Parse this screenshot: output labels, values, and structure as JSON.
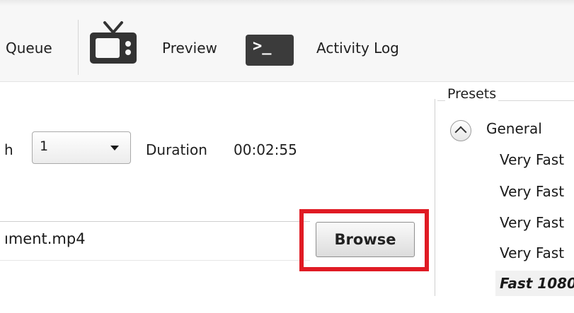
{
  "toolbar": {
    "queue_label": "Queue",
    "preview_label": "Preview",
    "activity_log_label": "Activity Log",
    "preview_icon": "tv-icon",
    "activity_log_icon": "terminal-icon",
    "terminal_glyph": ">_"
  },
  "source": {
    "partial_label": "h",
    "title_value": "1",
    "duration_label": "Duration",
    "duration_value": "00:02:55"
  },
  "destination": {
    "file_value": "ıment.mp4",
    "browse_label": "Browse",
    "highlight_color": "#e01b24"
  },
  "presets": {
    "legend": "Presets",
    "category": "General",
    "items": [
      "Very Fast",
      "Very Fast",
      "Very Fast",
      "Very Fast",
      "Fast 1080"
    ],
    "selected_index": 4
  }
}
